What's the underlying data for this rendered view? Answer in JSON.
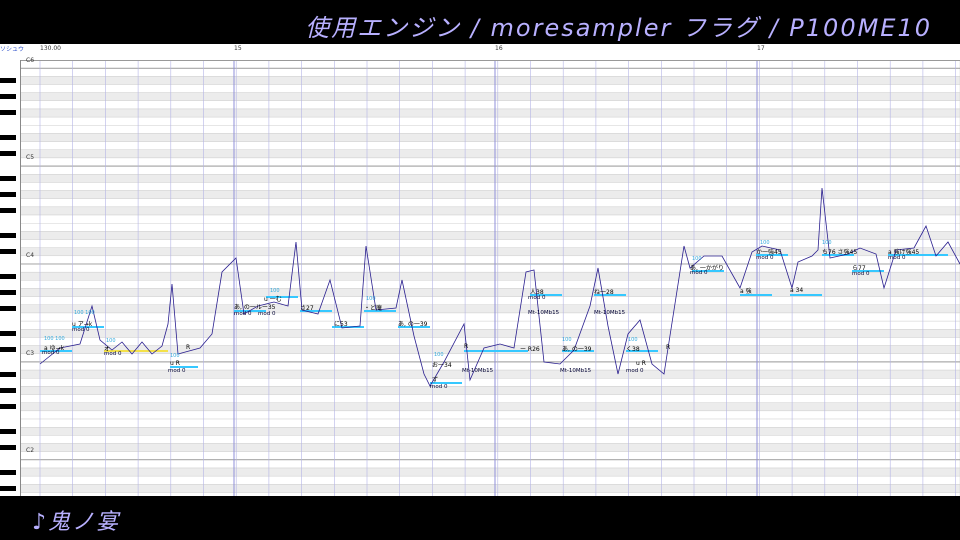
{
  "header": {
    "title": "使用エンジン / moresampler フラグ / P100ME10"
  },
  "footer": {
    "song": "♪鬼ノ宴"
  },
  "ruler": {
    "corner": "ソシュウ",
    "tempo": "130.00",
    "measures": [
      "15",
      "16",
      "17"
    ]
  },
  "octaves": [
    "C6",
    "C5",
    "C4",
    "C3",
    "C2"
  ],
  "colors": {
    "accent": "#b8b0ff",
    "note": "#36c8ff",
    "pitch": "#2a1f8f",
    "highlight": "#f4e14a"
  },
  "notes": [
    {
      "lyric": "a ゆ→k",
      "mod": "mod 0",
      "cval": "100 100"
    },
    {
      "lyric": "u ア→k",
      "mod": "mod 0",
      "cval": "100 100"
    },
    {
      "lyric": "オ",
      "mod": "mod 0",
      "cval": "100"
    },
    {
      "lyric": "R",
      "mod": "",
      "cval": ""
    },
    {
      "lyric": "u R",
      "mod": "mod 0",
      "cval": "100"
    },
    {
      "lyric": "あ, の一ルー35",
      "mod": "mod 0",
      "cval": "100"
    },
    {
      "lyric": "a 一ル",
      "mod": "mod 0",
      "cval": "100"
    },
    {
      "lyric": "u 一む",
      "mod": "mod 0",
      "cval": "100"
    },
    {
      "lyric": "さ27",
      "mod": "mod 0",
      "cval": "100"
    },
    {
      "lyric": "に53",
      "mod": "",
      "cval": "100"
    },
    {
      "lyric": "・ど庵",
      "mod": "",
      "cval": "100"
    },
    {
      "lyric": "あ, の一39",
      "mod": "",
      "cval": "100"
    },
    {
      "lyric": "お一34",
      "mod": "mod 0",
      "cval": "100"
    },
    {
      "lyric": "ず",
      "mod": "",
      "cval": "100"
    },
    {
      "lyric": "R",
      "mod": "Mt-10Mb15",
      "cval": "100"
    },
    {
      "lyric": "ー R26",
      "mod": "",
      "cval": "100"
    },
    {
      "lyric": "人38",
      "mod": "mod 0",
      "cval": "100"
    },
    {
      "lyric": "あ, の一39",
      "mod": "Mt-10Mb15",
      "cval": "100"
    },
    {
      "lyric": "ね一28",
      "mod": "Mt-10Mb15",
      "cval": "100"
    },
    {
      "lyric": "く38",
      "mod": "mod 0",
      "cval": "100"
    },
    {
      "lyric": "u R",
      "mod": "Mt-10Mb15",
      "cval": "100"
    },
    {
      "lyric": "R",
      "mod": "",
      "cval": ""
    },
    {
      "lyric": "あ, 一かがり",
      "mod": "mod 0",
      "cval": "100"
    },
    {
      "lyric": "か一強45",
      "mod": "mod 0",
      "cval": "100"
    },
    {
      "lyric": "a 強",
      "mod": "",
      "cval": "100"
    },
    {
      "lyric": "a 34",
      "mod": "",
      "cval": "100"
    },
    {
      "lyric": "ち76 さ強45",
      "mod": "mod 0",
      "cval": "100"
    },
    {
      "lyric": "ら77",
      "mod": "",
      "cval": "100"
    },
    {
      "lyric": "a 強け強45",
      "mod": "mod 0",
      "cval": "100"
    }
  ]
}
